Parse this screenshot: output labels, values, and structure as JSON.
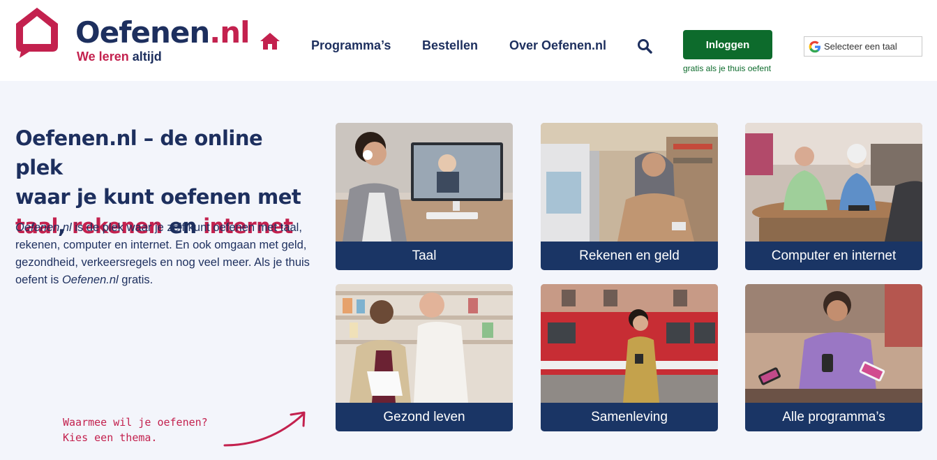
{
  "header": {
    "logo_name": "Oefenen",
    "logo_tld": ".nl",
    "tagline_part1": "We leren",
    "tagline_part2": "altijd",
    "nav": [
      "Programma’s",
      "Bestellen",
      "Over Oefenen.nl"
    ],
    "login_label": "Inloggen",
    "login_sub": "gratis als je thuis oefent",
    "translate_label": "Selecteer een taal"
  },
  "icons": {
    "home": "home-icon",
    "search": "search-icon",
    "google": "google-icon"
  },
  "colors": {
    "brand_dark": "#1d2f5e",
    "brand_accent": "#c3214e",
    "login_green": "#0d6b2c",
    "tile_label_bg": "#1a3565",
    "page_bg": "#f3f5fb"
  },
  "intro": {
    "title_line1": "Oefenen.nl – de online plek",
    "title_line2": "waar je kunt oefenen met",
    "title_word_taal": "taal",
    "title_comma": ", ",
    "title_word_rekenen": "rekenen",
    "title_en": " en ",
    "title_word_internet": "internet",
    "body_em1": "Oefenen.nl",
    "body_part1": " is de plek waar je zelf kunt oefenen met taal, rekenen, computer en internet. En ook omgaan met geld, gezondheid, verkeersregels en nog veel meer. Als je thuis oefent is ",
    "body_em2": "Oefenen.nl",
    "body_part2": " gratis."
  },
  "handnote": {
    "line1": "Waarmee wil je oefenen?",
    "line2": "Kies een thema."
  },
  "tiles": [
    {
      "label": "Taal",
      "image": "woman-with-headset-at-computer"
    },
    {
      "label": "Rekenen en geld",
      "image": "woman-with-card-at-machine"
    },
    {
      "label": "Computer en internet",
      "image": "seniors-with-tablet"
    },
    {
      "label": "Gezond leven",
      "image": "man-at-pharmacy"
    },
    {
      "label": "Samenleving",
      "image": "woman-with-phone-near-tram"
    },
    {
      "label": "Alle programma’s",
      "image": "people-with-phones"
    }
  ]
}
